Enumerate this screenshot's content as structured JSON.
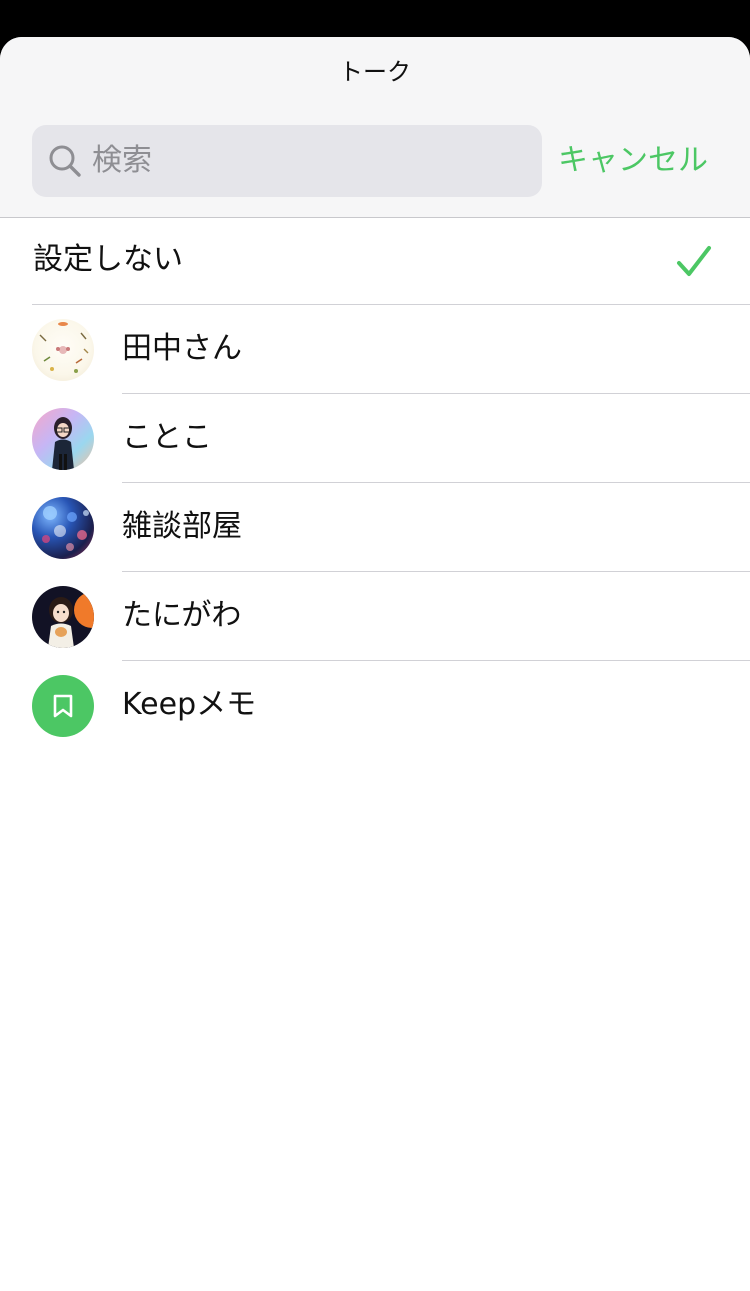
{
  "sheet": {
    "title": "トーク"
  },
  "search": {
    "placeholder": "検索",
    "cancel_label": "キャンセル"
  },
  "options": {
    "none_label": "設定しない",
    "none_selected": true
  },
  "chats": [
    {
      "name": "田中さん",
      "avatar": "tanaka-avatar"
    },
    {
      "name": "ことこ",
      "avatar": "kotoko-avatar"
    },
    {
      "name": "雑談部屋",
      "avatar": "zatsudan-avatar"
    },
    {
      "name": "たにがわ",
      "avatar": "tanigawa-avatar"
    },
    {
      "name": "Keepメモ",
      "avatar": "bookmark-icon"
    }
  ],
  "colors": {
    "accent": "#4cc764",
    "header_bg": "#f6f6f7",
    "search_bg": "#e5e5ea",
    "placeholder": "#8e8e93"
  }
}
